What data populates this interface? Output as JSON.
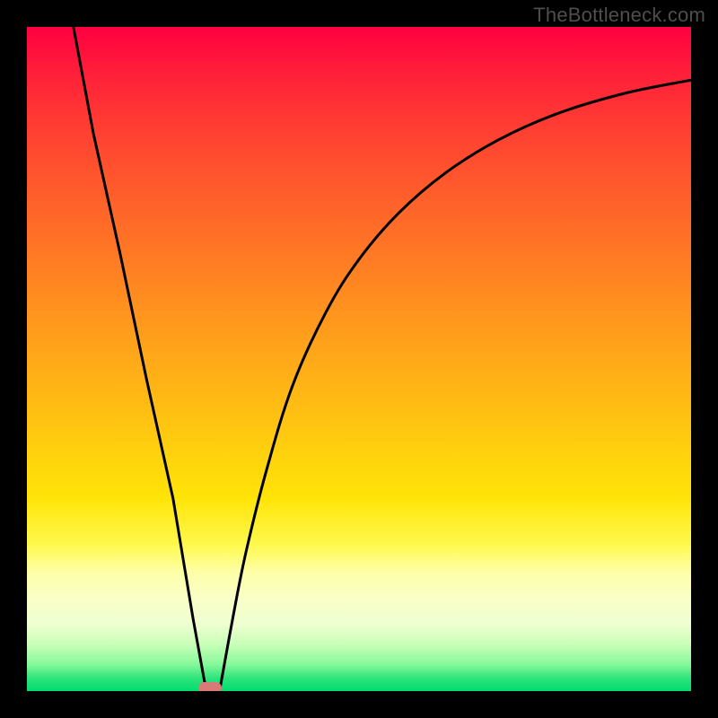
{
  "watermark": "TheBottleneck.com",
  "chart_data": {
    "type": "line",
    "title": "",
    "xlabel": "",
    "ylabel": "",
    "xlim": [
      0,
      100
    ],
    "ylim": [
      0,
      100
    ],
    "legend": false,
    "grid": false,
    "background": "red-yellow-green vertical gradient",
    "series": [
      {
        "name": "left-branch",
        "x": [
          7,
          10,
          14,
          18,
          22,
          25,
          27
        ],
        "values": [
          100,
          84,
          66,
          47,
          29,
          11,
          0
        ]
      },
      {
        "name": "right-branch",
        "x": [
          29,
          31,
          33,
          36,
          40,
          45,
          50,
          56,
          63,
          71,
          80,
          90,
          100
        ],
        "values": [
          0,
          11,
          21,
          33,
          46,
          57,
          65,
          72,
          78,
          83,
          87,
          90,
          92
        ]
      }
    ],
    "marker": {
      "name": "optimal-point",
      "x": 27.5,
      "y": 0.5,
      "color": "#d87b77",
      "shape": "rounded-rect"
    }
  },
  "colors": {
    "frame": "#000000",
    "curve": "#000000",
    "marker": "#d87b77",
    "watermark": "#4e4e4e"
  }
}
